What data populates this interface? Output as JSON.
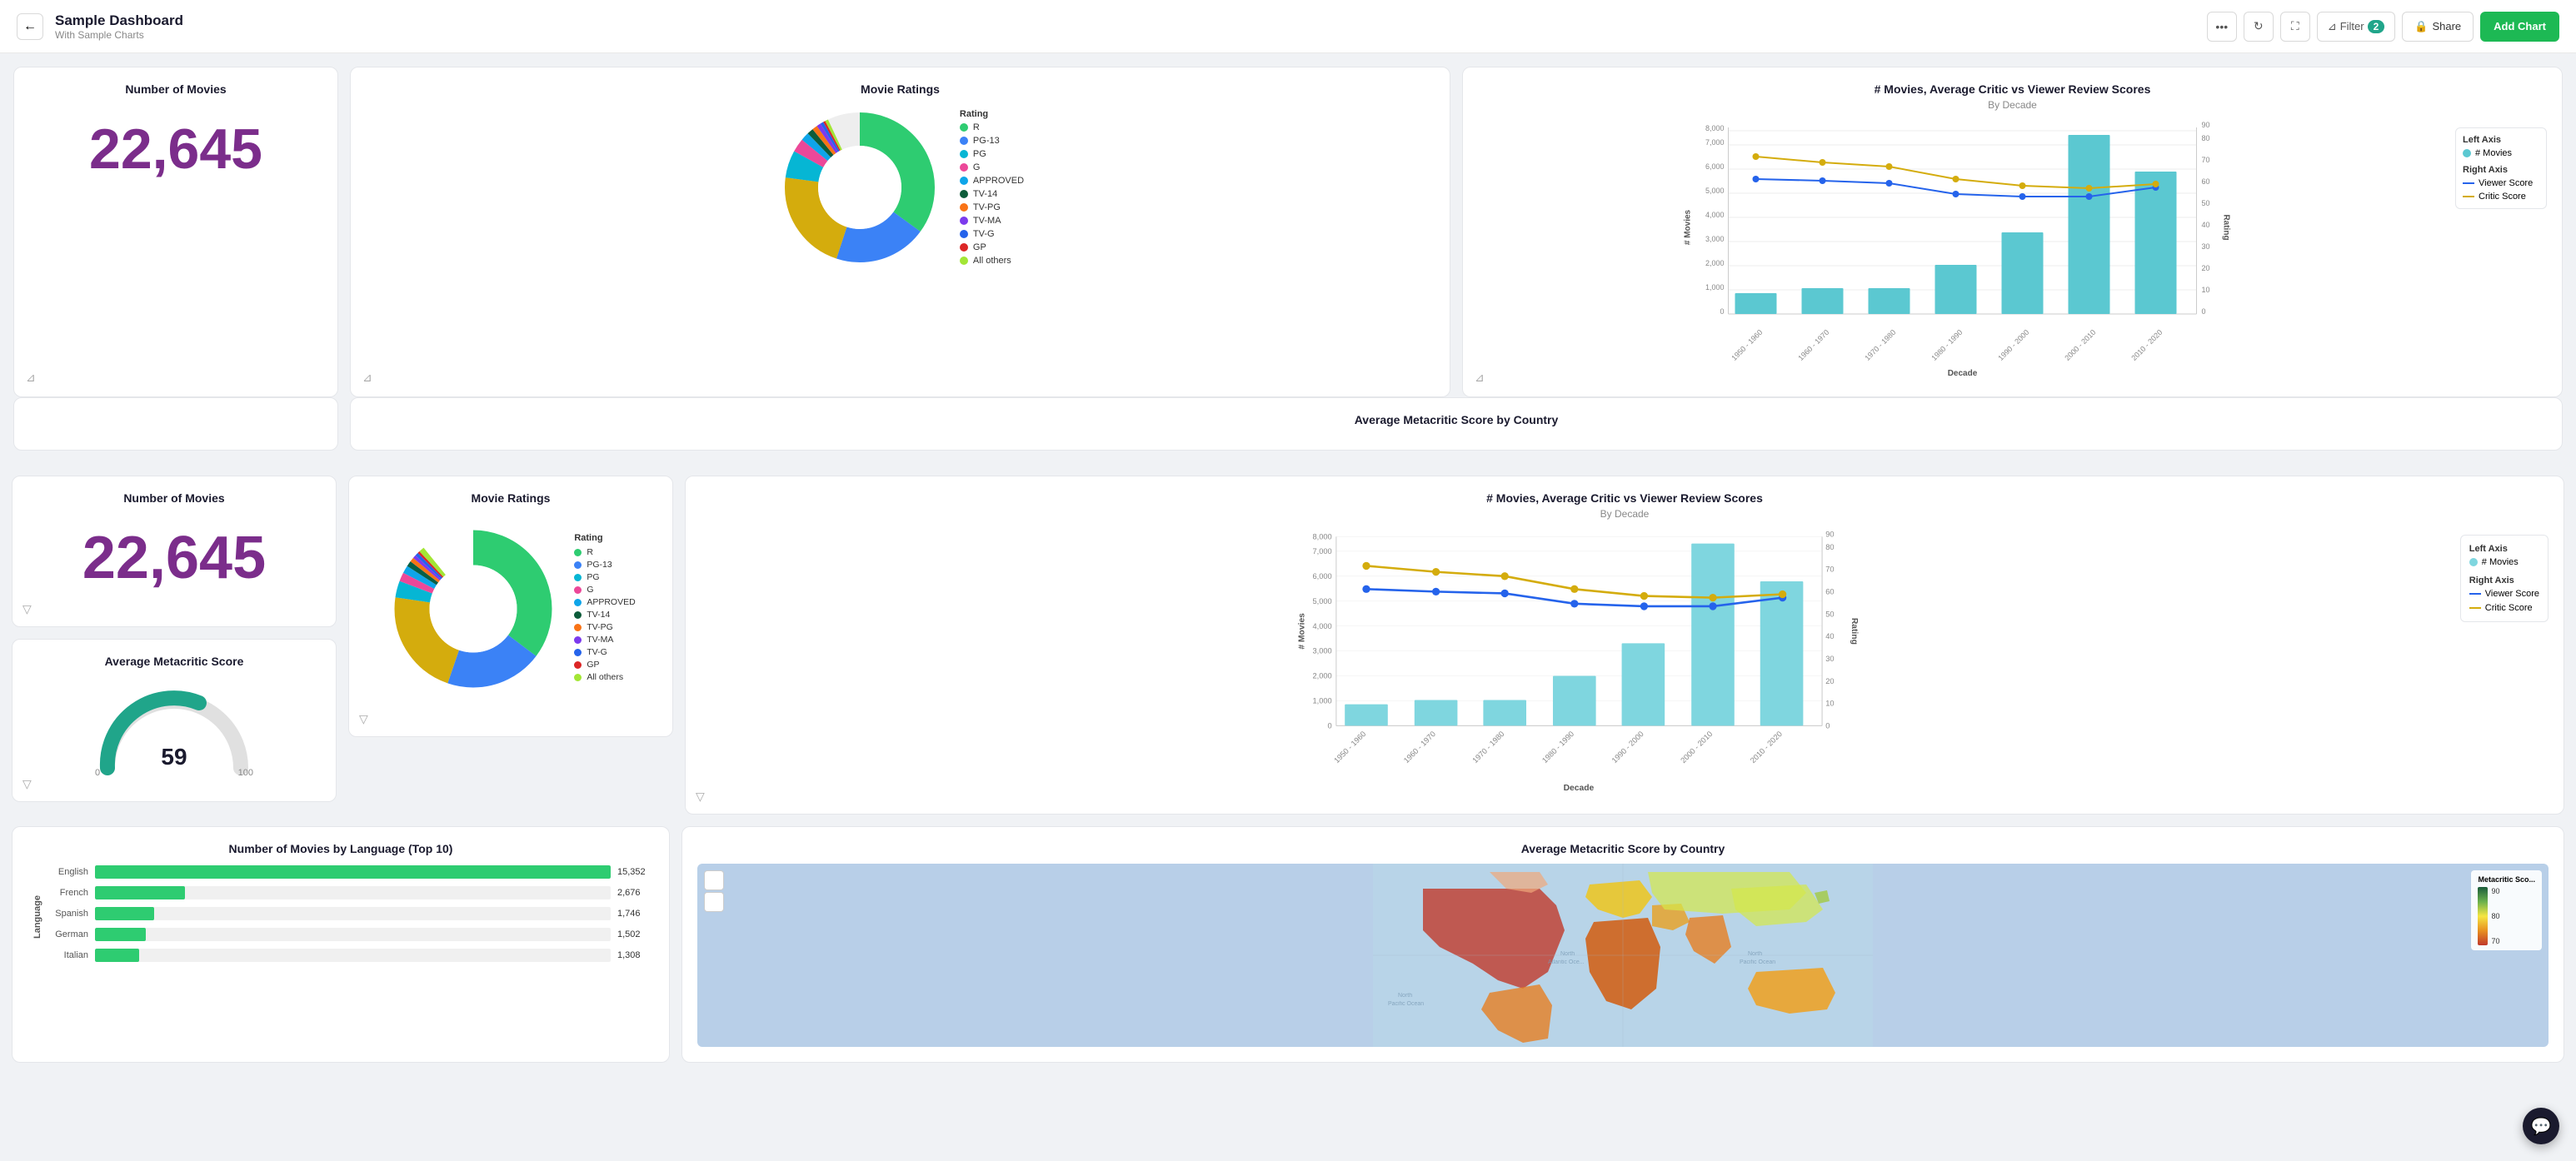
{
  "header": {
    "back_label": "←",
    "title": "Sample Dashboard",
    "subtitle": "With Sample Charts",
    "more_label": "•••",
    "refresh_label": "↻",
    "fullscreen_label": "⛶",
    "filter_label": "Filter",
    "filter_count": "2",
    "share_label": "Share",
    "add_chart_label": "Add Chart"
  },
  "cards": {
    "movies_count": {
      "title": "Number of Movies",
      "value": "22,645",
      "filter_icon": "⊿"
    },
    "metacritic": {
      "title": "Average Metacritic Score",
      "value": "59",
      "min": "0",
      "max": "100"
    },
    "ratings": {
      "title": "Movie Ratings",
      "legend_title": "Rating",
      "legend_items": [
        {
          "label": "R",
          "color": "#2ecc71"
        },
        {
          "label": "PG-13",
          "color": "#3b82f6"
        },
        {
          "label": "PG",
          "color": "#06b6d4"
        },
        {
          "label": "G",
          "color": "#ec4899"
        },
        {
          "label": "APPROVED",
          "color": "#0ea5e9"
        },
        {
          "label": "TV-14",
          "color": "#0d5c3a"
        },
        {
          "label": "TV-PG",
          "color": "#f97316"
        },
        {
          "label": "TV-MA",
          "color": "#7c3aed"
        },
        {
          "label": "TV-G",
          "color": "#2563eb"
        },
        {
          "label": "GP",
          "color": "#dc2626"
        },
        {
          "label": "All others",
          "color": "#a3e635"
        }
      ]
    },
    "combined_chart": {
      "title": "# Movies, Average Critic vs Viewer Review Scores",
      "subtitle": "By Decade",
      "x_label": "Decade",
      "y_left_label": "# Movies",
      "y_right_label": "Rating",
      "left_axis_label": "Left Axis",
      "left_axis_item": "# Movies",
      "right_axis_label": "Right Axis",
      "viewer_score_label": "Viewer Score",
      "critic_score_label": "Critic Score",
      "decades": [
        "1950 - 1960",
        "1960 - 1970",
        "1970 - 1980",
        "1980 - 1990",
        "1990 - 2000",
        "2000 - 2010",
        "2010 - 2020"
      ],
      "bar_values": [
        900,
        1100,
        1100,
        2100,
        3500,
        7700,
        6100
      ],
      "viewer_scores": [
        65,
        64,
        63,
        58,
        57,
        57,
        61
      ],
      "critic_scores": [
        76,
        73,
        71,
        65,
        62,
        61,
        63
      ],
      "y_left_max": 8000,
      "y_right_max": 90,
      "y_left_ticks": [
        0,
        1000,
        2000,
        3000,
        4000,
        5000,
        6000,
        7000,
        8000
      ],
      "y_right_ticks": [
        0,
        10,
        20,
        30,
        40,
        50,
        60,
        70,
        80,
        90
      ]
    },
    "languages": {
      "title": "Number of Movies by Language (Top 10)",
      "y_label": "Language",
      "bars": [
        {
          "label": "English",
          "value": 15352,
          "display": "15,352"
        },
        {
          "label": "French",
          "value": 2676,
          "display": "2,676"
        },
        {
          "label": "Spanish",
          "value": 1746,
          "display": "1,746"
        },
        {
          "label": "German",
          "value": 1502,
          "display": "1,502"
        },
        {
          "label": "Italian",
          "value": 1308,
          "display": "1,308"
        }
      ],
      "max_value": 15352
    },
    "map": {
      "title": "Average Metacritic Score by Country",
      "legend_title": "Metacritic Sco...",
      "zoom_in": "+",
      "zoom_out": "−",
      "legend_values": [
        "90",
        "80",
        "70"
      ]
    }
  }
}
